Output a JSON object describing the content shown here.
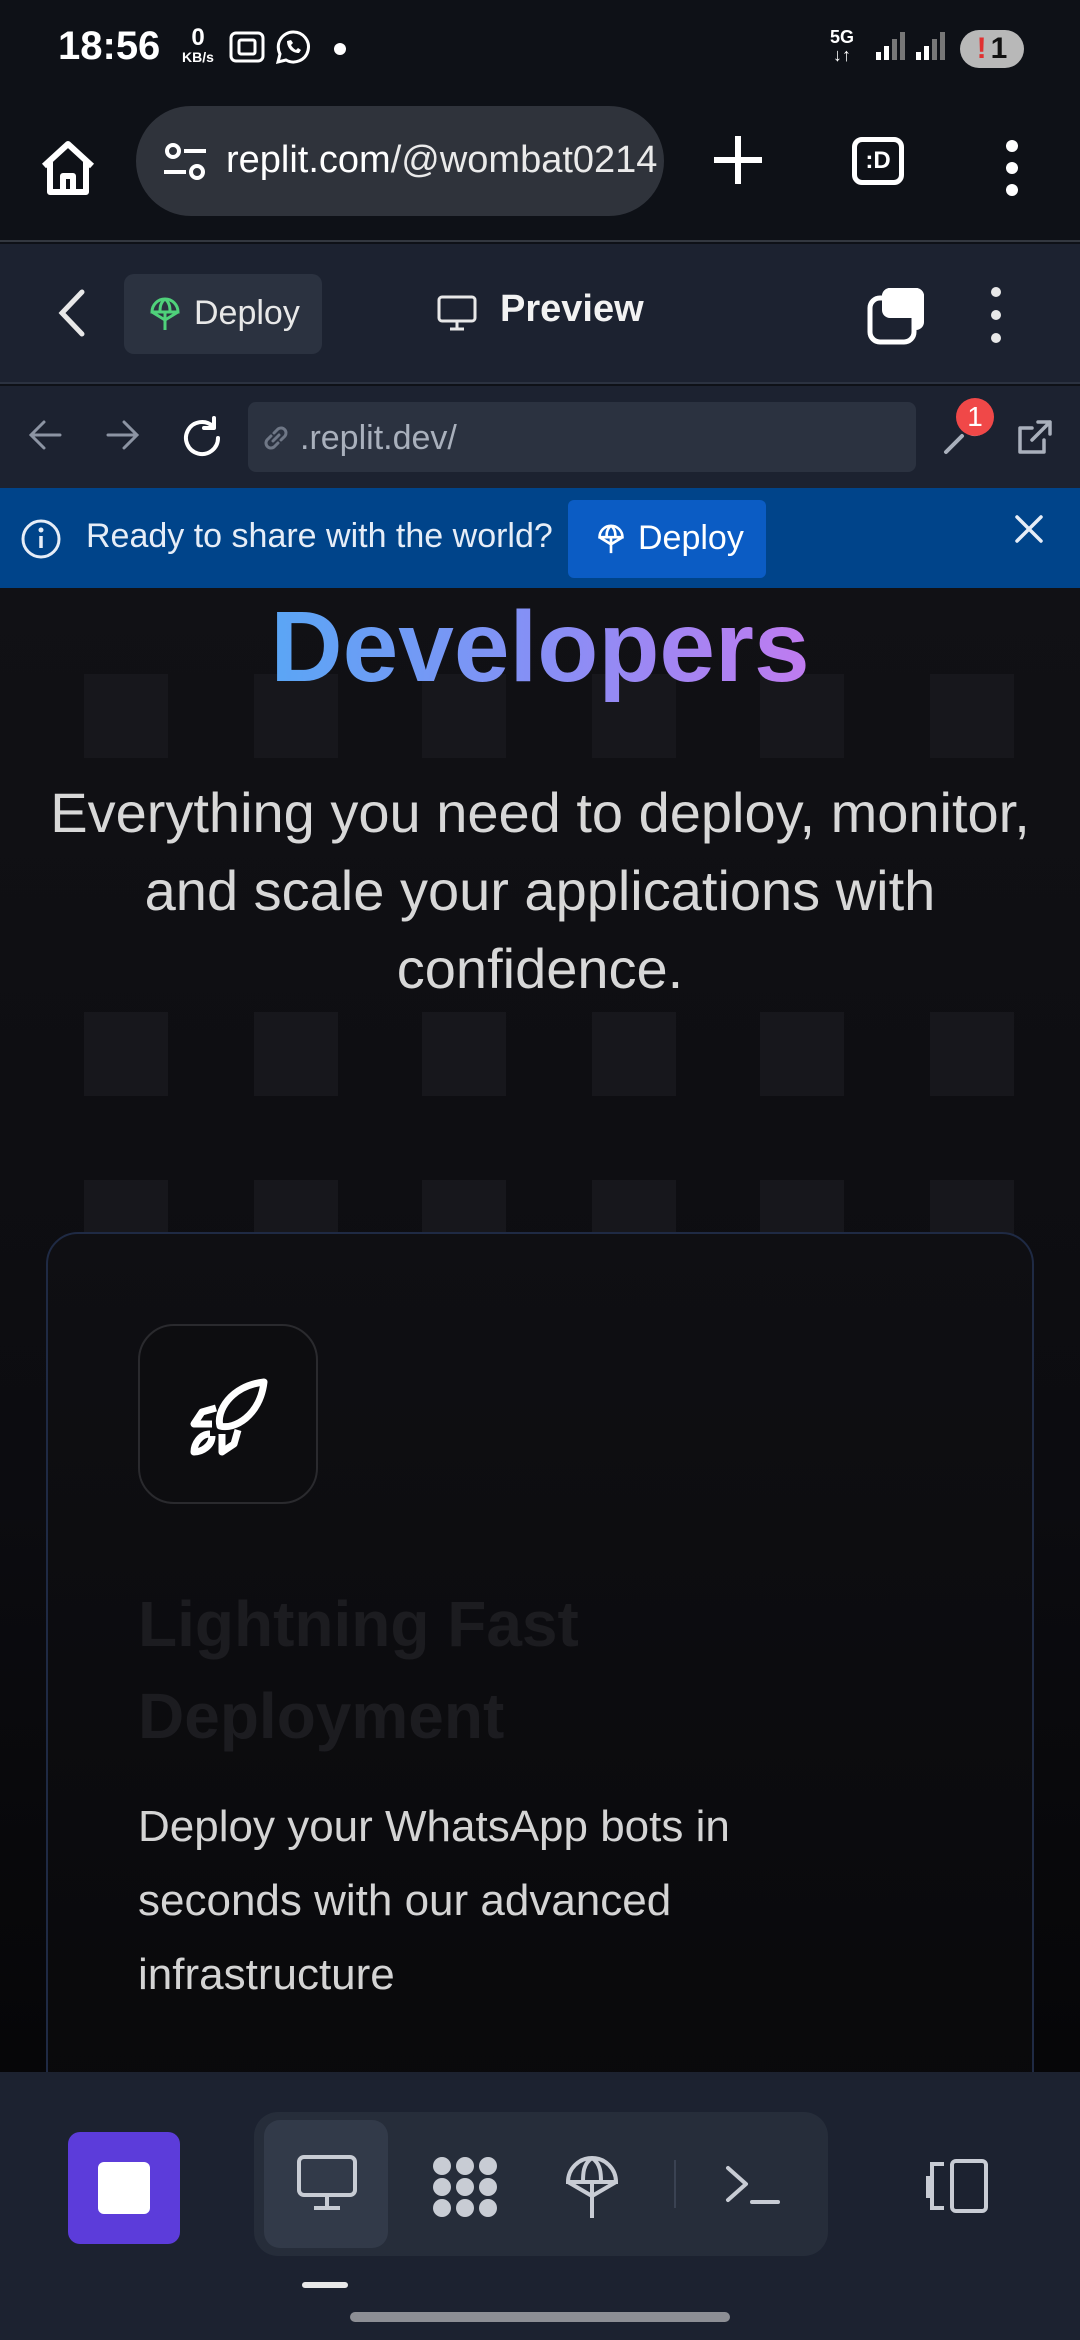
{
  "status_bar": {
    "time": "18:56",
    "net_speed_value": "0",
    "net_speed_unit": "KB/s",
    "network_label": "5G",
    "battery_level": "1",
    "icons": [
      "screenshot-icon",
      "whatsapp-icon",
      "signal-icon",
      "battery-icon"
    ]
  },
  "browser": {
    "url_host": "replit.com",
    "url_path": "/@wombat0214",
    "tabs_label": ":D"
  },
  "replit_header": {
    "deploy_tab_label": "Deploy",
    "preview_tab_label": "Preview"
  },
  "address_row": {
    "url": ".replit.dev/",
    "notification_count": "1"
  },
  "banner": {
    "message": "Ready to share with the world?",
    "deploy_label": "Deploy",
    "color": "#00448a"
  },
  "content": {
    "heading": "Developers",
    "subtitle": "Everything you need to deploy, monitor, and scale your applications with confidence.",
    "card": {
      "icon": "rocket-icon",
      "title": "Lightning Fast Deployment",
      "description": "Deploy your WhatsApp bots in seconds with our advanced infrastructure"
    }
  },
  "bottom_toolbar": {
    "tools": [
      "preview-icon",
      "workflows-icon",
      "deploy-icon",
      "shell-icon"
    ],
    "accent": "#5c3cda"
  }
}
